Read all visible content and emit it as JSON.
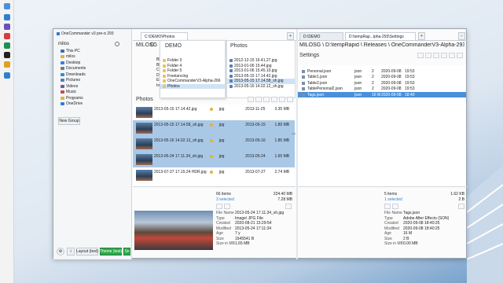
{
  "window": {
    "title": "OneCommander v3 pre-α 293",
    "accent": "#2f7fd1"
  },
  "left_panel": {
    "computer_label": "milos",
    "items": [
      {
        "label": "This PC",
        "icon": "monitor-icon",
        "color": "#3a6fb0"
      },
      {
        "label": "milos",
        "icon": "user-folder-icon",
        "color": "#e3b23c"
      },
      {
        "label": "Desktop",
        "icon": "desktop-icon",
        "color": "#3d7fd0"
      },
      {
        "label": "Documents",
        "icon": "documents-icon",
        "color": "#7a7a7a"
      },
      {
        "label": "Downloads",
        "icon": "download-icon",
        "color": "#2f8fd0"
      },
      {
        "label": "Pictures",
        "icon": "pictures-icon",
        "color": "#5a7fb0"
      },
      {
        "label": "Videos",
        "icon": "videos-icon",
        "color": "#6f5ab0"
      },
      {
        "label": "Music",
        "icon": "music-icon",
        "color": "#c0504d"
      },
      {
        "label": "Programs",
        "icon": "programs-icon",
        "color": "#e3b23c"
      },
      {
        "label": "OneDrive",
        "icon": "cloud-icon",
        "color": "#2d7fd6"
      }
    ],
    "new_group_label": "New Group",
    "layout_label": "Layout (test)",
    "theme_label": "Theme (test)",
    "extra_label": "Sn"
  },
  "left_pane": {
    "tab_path": "C:\\DEMO\\Photos",
    "crumbs": [
      "MILOSG",
      "C:",
      "DEMO",
      "Photos"
    ],
    "demo_header": "DEMO",
    "demo_items": [
      "Folder 3",
      "Folder 4",
      "Folder 5",
      "Freelancing",
      "OneCommanderV3-Alpha-266",
      "Photos"
    ],
    "side_letters": [
      "BM",
      "BR",
      "CR",
      "DE",
      "ES",
      "Int"
    ],
    "photos_header": "Photos",
    "photos_items": [
      "2012-12-15 16.41.27.jpg",
      "2013-01-06 15.44.jpg",
      "2013-01-06 15.45.10.jpg",
      "2013-05-15 17.14.42.jpg",
      "2013-05-15 17.14.58_sh.jpg",
      "2013-05-16 14.02.12_sh.jpg"
    ],
    "list_title": "Photos",
    "rows": [
      {
        "name": "2013-05-15 17.14.42.jpg",
        "type": "jpg",
        "date": "2013-11-25",
        "size": "3.35 MB",
        "selected": false
      },
      {
        "name": "2013-05-15 17.14.58_sh.jpg",
        "type": "jpg",
        "date": "2013-05-15",
        "size": "1.89 MB",
        "selected": true
      },
      {
        "name": "2013-05-16 14.02.12_sh.jpg",
        "type": "jpg",
        "date": "2013-05-16",
        "size": "1.85 MB",
        "selected": true
      },
      {
        "name": "2013-05-24 17.11.34_sh.jpg",
        "type": "jpg",
        "date": "2013-05-24",
        "size": "1.65 MB",
        "selected": true
      },
      {
        "name": "2013-07-27 17.15.24 HDR.jpg",
        "type": "jpg",
        "date": "2013-07-27",
        "size": "2.74 MB",
        "selected": false
      }
    ],
    "summary": {
      "items": "66 items",
      "selected": "3 selected",
      "total": "224.40 MB",
      "selected_size": "7.28 MB"
    },
    "properties": [
      {
        "k": "File Name",
        "v": "2013-05-24 17.11.34_sh.jpg"
      },
      {
        "k": "Type",
        "v": "Image\\ JPG File"
      },
      {
        "k": "Created",
        "v": "2020-08-21 15:29:54"
      },
      {
        "k": "Modified",
        "v": "2013-05-24 17:11:34"
      },
      {
        "k": "Age",
        "v": "7 y"
      },
      {
        "k": "Size",
        "v": "1645541 B"
      },
      {
        "k": "Size in MB",
        "v": "1.65 MB"
      }
    ]
  },
  "right_pane": {
    "tabs": [
      "D:\\DEMO",
      "D:\\tempRap...lpha-293\\Settings"
    ],
    "path": "MILOSG \\ D:\\tempRapid \\ Releases \\ OneCommanderV3-Alpha-293 \\ Settings",
    "header": "Settings",
    "rows": [
      {
        "name": "Personal.json",
        "type": "json",
        "n": "2",
        "date": "2020-09-08",
        "time": "19:53",
        "selected": false
      },
      {
        "name": "Table1.json",
        "type": "json",
        "n": "2",
        "date": "2020-09-08",
        "time": "19:53",
        "selected": false
      },
      {
        "name": "Table2.json",
        "type": "json",
        "n": "2",
        "date": "2020-09-08",
        "time": "19:53",
        "selected": false
      },
      {
        "name": "TablePersonal2.json",
        "type": "json",
        "n": "2",
        "date": "2020-09-08",
        "time": "19:53",
        "selected": false
      },
      {
        "name": "Tags.json",
        "type": "json",
        "n": "16 M",
        "date": "2020-09-08",
        "time": "18:40",
        "selected": true
      }
    ],
    "summary": {
      "items": "5 items",
      "selected": "1 selected",
      "total": "1.62 KB",
      "selected_size": "2 B"
    },
    "properties": [
      {
        "k": "File Name",
        "v": "Tags.json"
      },
      {
        "k": "Type",
        "v": "Adobe After Effects (SON)"
      },
      {
        "k": "Created",
        "v": "2020-09-08 18:40:25"
      },
      {
        "k": "Modified",
        "v": "2020-09-08 18:40:25"
      },
      {
        "k": "Age",
        "v": "16 M"
      },
      {
        "k": "Size",
        "v": "2 B"
      },
      {
        "k": "Size in MB",
        "v": "0.00 MB"
      }
    ]
  }
}
